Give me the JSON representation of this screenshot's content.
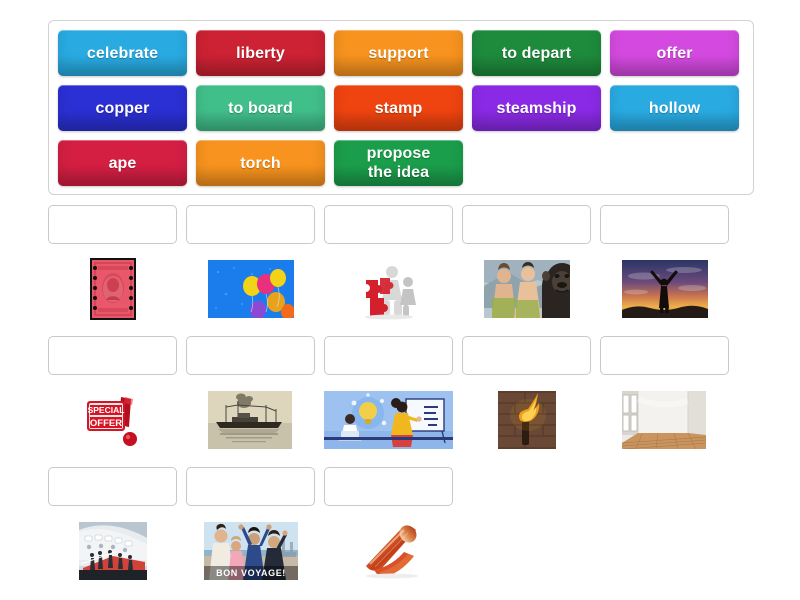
{
  "activity": {
    "type": "match-up-drag-and-drop",
    "word_bank": {
      "rows": [
        [
          {
            "label": "celebrate",
            "color": "#29abe2"
          },
          {
            "label": "liberty",
            "color": "#cc2233"
          },
          {
            "label": "support",
            "color": "#f7931e"
          },
          {
            "label": "to depart",
            "color": "#1e8b3c"
          },
          {
            "label": "offer",
            "color": "#d44ae0"
          }
        ],
        [
          {
            "label": "copper",
            "color": "#2b30d4"
          },
          {
            "label": "to board",
            "color": "#41bf8a"
          },
          {
            "label": "stamp",
            "color": "#ef4410"
          },
          {
            "label": "steamship",
            "color": "#8b2ae6"
          },
          {
            "label": "hollow",
            "color": "#29abe2"
          }
        ],
        [
          {
            "label": "ape",
            "color": "#d41f43"
          },
          {
            "label": "torch",
            "color": "#f7931e"
          },
          {
            "label": "propose\nthe idea",
            "color": "#1b9e4b"
          }
        ]
      ]
    },
    "answer_rows": [
      [
        {
          "dropzone_value": "",
          "image_name": "red-postage-stamp-washington"
        },
        {
          "dropzone_value": "",
          "image_name": "balloons-in-blue-sky"
        },
        {
          "dropzone_value": "",
          "image_name": "figures-with-red-puzzle-piece"
        },
        {
          "dropzone_value": "",
          "image_name": "men-with-gorilla-ape"
        },
        {
          "dropzone_value": "",
          "image_name": "silhouette-arms-raised-sunset"
        }
      ],
      [
        {
          "dropzone_value": "",
          "image_name": "special-offer-badge"
        },
        {
          "dropzone_value": "",
          "image_name": "vintage-steamship-sepia"
        },
        {
          "dropzone_value": "",
          "image_name": "people-presenting-idea-lightbulb"
        },
        {
          "dropzone_value": "",
          "image_name": "burning-torch-on-brick-wall"
        },
        {
          "dropzone_value": "",
          "image_name": "empty-room-wooden-floor"
        }
      ],
      [
        {
          "dropzone_value": "",
          "image_name": "passengers-boarding-ship"
        },
        {
          "dropzone_value": "",
          "image_name": "bon-voyage-waving-goodbye"
        },
        {
          "dropzone_value": "",
          "image_name": "copper-foil-sheet-roll"
        }
      ]
    ],
    "image_captions": {
      "bon_voyage": "BON VOYAGE!",
      "special_offer_line1": "SPECIAL",
      "special_offer_line2": "OFFER"
    },
    "colors": {
      "page_background": "#ffffff",
      "bank_border": "#d2d2d2",
      "dropzone_border": "#c9c9c9",
      "tile_text": "#ffffff"
    }
  }
}
